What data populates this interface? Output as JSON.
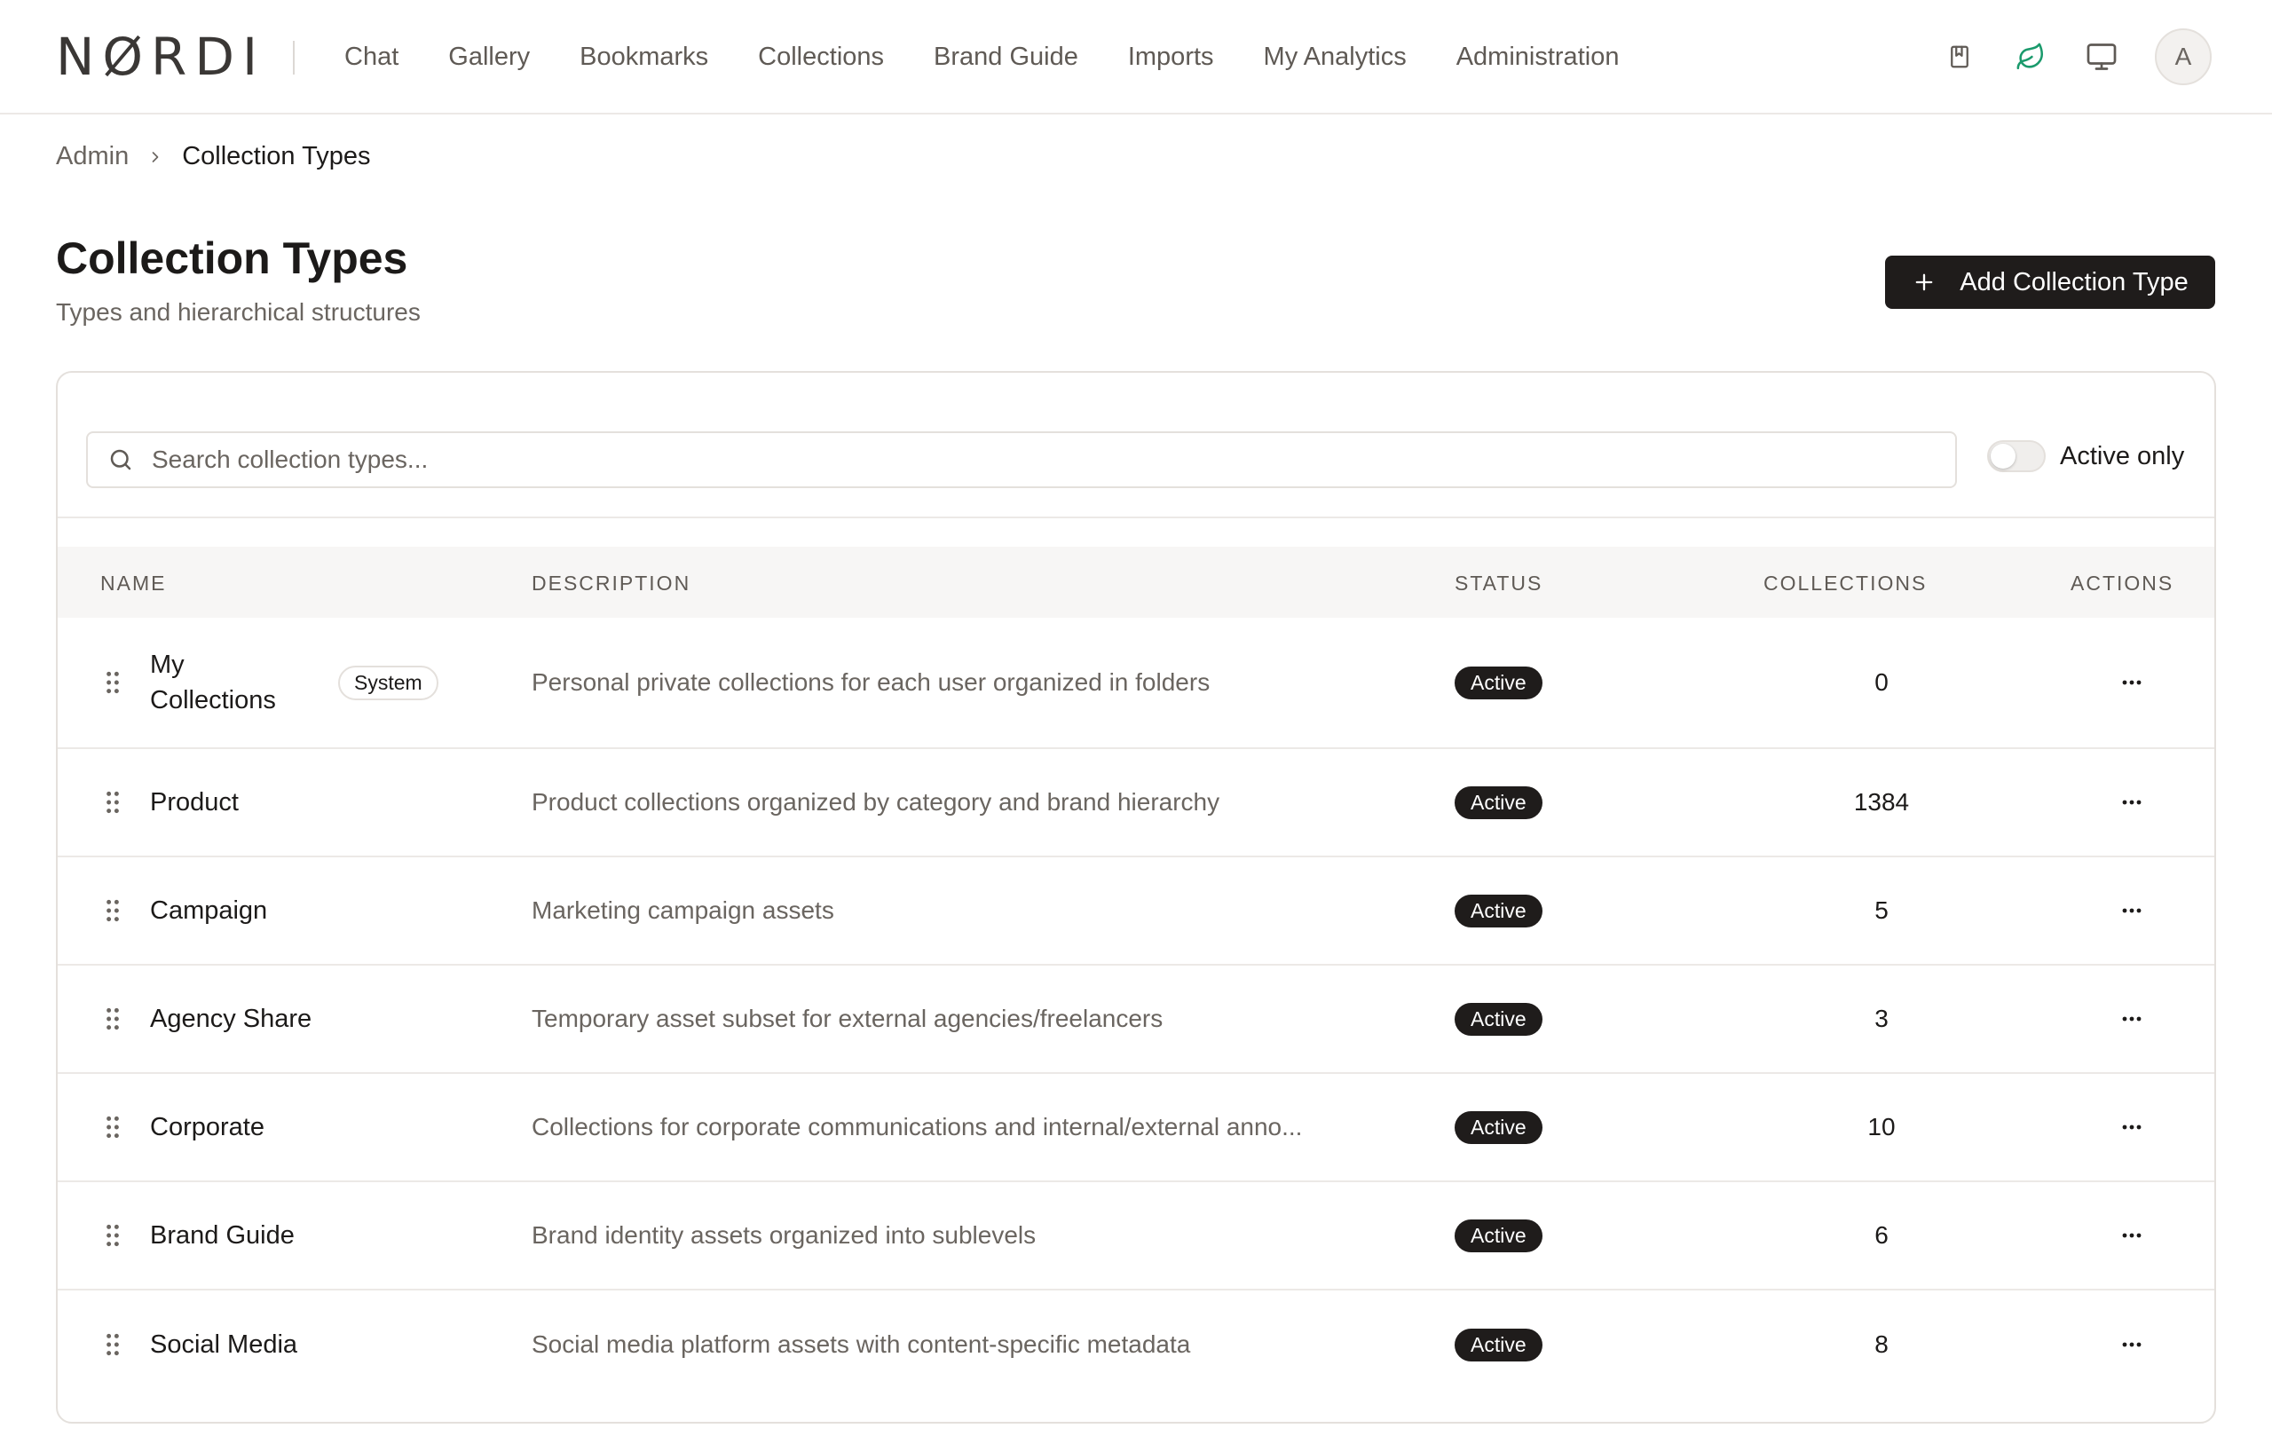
{
  "header": {
    "logo": "NØRDI",
    "nav": [
      "Chat",
      "Gallery",
      "Bookmarks",
      "Collections",
      "Brand Guide",
      "Imports",
      "My Analytics",
      "Administration"
    ],
    "avatar_initial": "A"
  },
  "breadcrumb": {
    "parent": "Admin",
    "current": "Collection Types"
  },
  "page": {
    "title": "Collection Types",
    "subtitle": "Types and hierarchical structures",
    "add_button": "Add Collection Type"
  },
  "filters": {
    "search_placeholder": "Search collection types...",
    "active_only_label": "Active only",
    "active_only": false
  },
  "table": {
    "columns": [
      "NAME",
      "DESCRIPTION",
      "STATUS",
      "COLLECTIONS",
      "ACTIONS"
    ],
    "rows": [
      {
        "name_line1": "My",
        "name_line2": "Collections",
        "badge": "System",
        "description": "Personal private collections for each user organized in folders",
        "status": "Active",
        "collections": "0"
      },
      {
        "name": "Product",
        "description": "Product collections organized by category and brand hierarchy",
        "status": "Active",
        "collections": "1384"
      },
      {
        "name": "Campaign",
        "description": "Marketing campaign assets",
        "status": "Active",
        "collections": "5"
      },
      {
        "name": "Agency Share",
        "description": "Temporary asset subset for external agencies/freelancers",
        "status": "Active",
        "collections": "3"
      },
      {
        "name": "Corporate",
        "description": "Collections for corporate communications and internal/external anno...",
        "status": "Active",
        "collections": "10"
      },
      {
        "name": "Brand Guide",
        "description": "Brand identity assets organized into sublevels",
        "status": "Active",
        "collections": "6"
      },
      {
        "name": "Social Media",
        "description": "Social media platform assets with content-specific metadata",
        "status": "Active",
        "collections": "8"
      }
    ]
  },
  "colors": {
    "accent_dark": "#1f1c1b",
    "leaf_green": "#1a9a6c",
    "muted_text": "#6a6560"
  },
  "icons": [
    "bookmark-icon",
    "leaf-icon",
    "monitor-icon",
    "search-icon",
    "plus-icon",
    "drag-handle-icon",
    "more-horizontal-icon",
    "chevron-right-icon"
  ]
}
